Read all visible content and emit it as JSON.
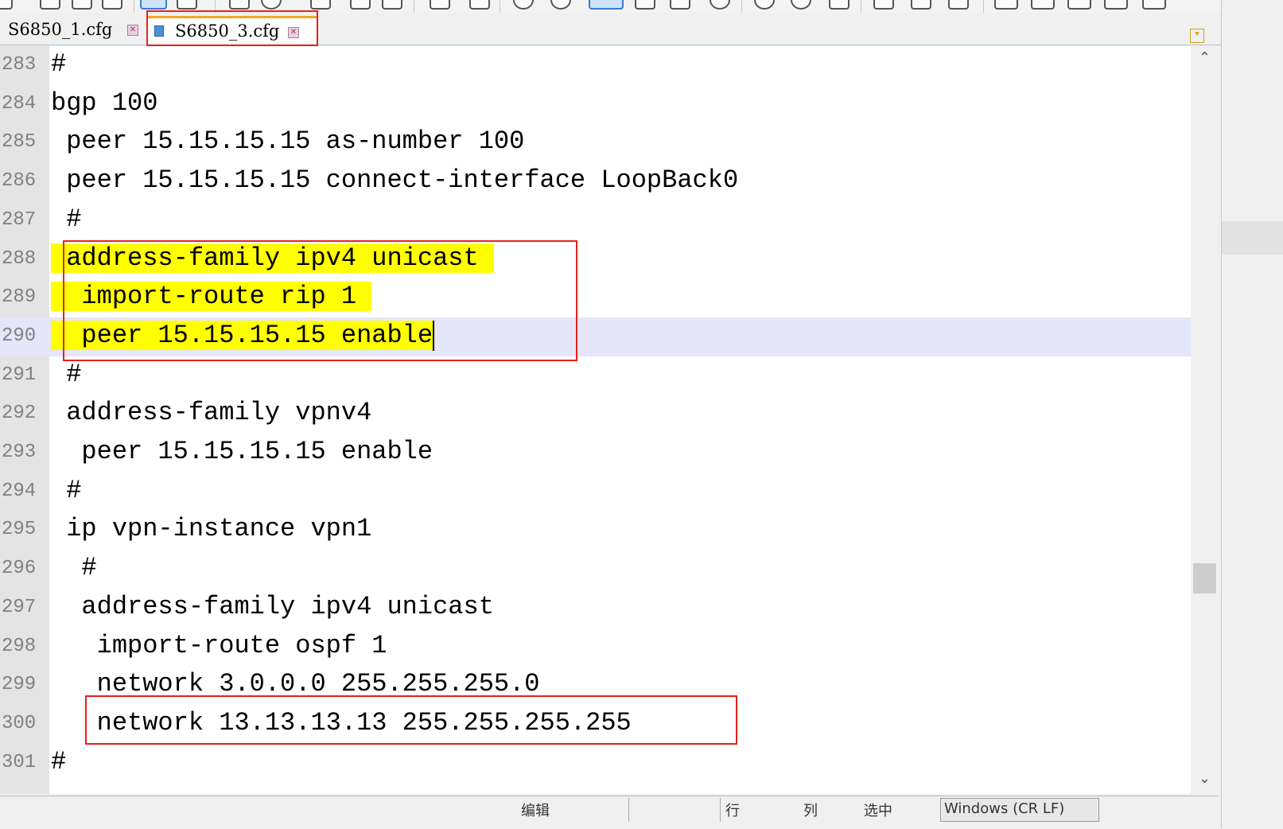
{
  "tabs": [
    {
      "label": "S6850_1.cfg",
      "close": "✕"
    },
    {
      "label": "S6850_3.cfg",
      "close": "✕"
    }
  ],
  "tab_dropdown": "⯆",
  "editor": {
    "lines": [
      {
        "num": "283",
        "text": "#"
      },
      {
        "num": "284",
        "text": "bgp 100"
      },
      {
        "num": "285",
        "text": " peer 15.15.15.15 as-number 100"
      },
      {
        "num": "286",
        "text": " peer 15.15.15.15 connect-interface LoopBack0"
      },
      {
        "num": "287",
        "text": " #"
      },
      {
        "num": "288",
        "text": " address-family ipv4 unicast "
      },
      {
        "num": "289",
        "text": "  import-route rip 1 "
      },
      {
        "num": "290",
        "text": "  peer 15.15.15.15 enable"
      },
      {
        "num": "291",
        "text": " #"
      },
      {
        "num": "292",
        "text": " address-family vpnv4"
      },
      {
        "num": "293",
        "text": "  peer 15.15.15.15 enable"
      },
      {
        "num": "294",
        "text": " #"
      },
      {
        "num": "295",
        "text": " ip vpn-instance vpn1"
      },
      {
        "num": "296",
        "text": "  #"
      },
      {
        "num": "297",
        "text": "  address-family ipv4 unicast"
      },
      {
        "num": "298",
        "text": "   import-route ospf 1"
      },
      {
        "num": "299",
        "text": "   network 3.0.0.0 255.255.255.0"
      },
      {
        "num": "300",
        "text": "   network 13.13.13.13 255.255.255.255"
      },
      {
        "num": "301",
        "text": "#"
      }
    ],
    "highlight_color": "#ffff00",
    "current_line_color": "#e6e6fa",
    "annotation_color": "#e8201e"
  },
  "scrollbar": {
    "up": "⌃",
    "down": "⌄"
  },
  "status": {
    "s1": "编辑",
    "s2": "行",
    "s3": "列",
    "s4": "选中",
    "s5": "Windows (CR LF)"
  }
}
